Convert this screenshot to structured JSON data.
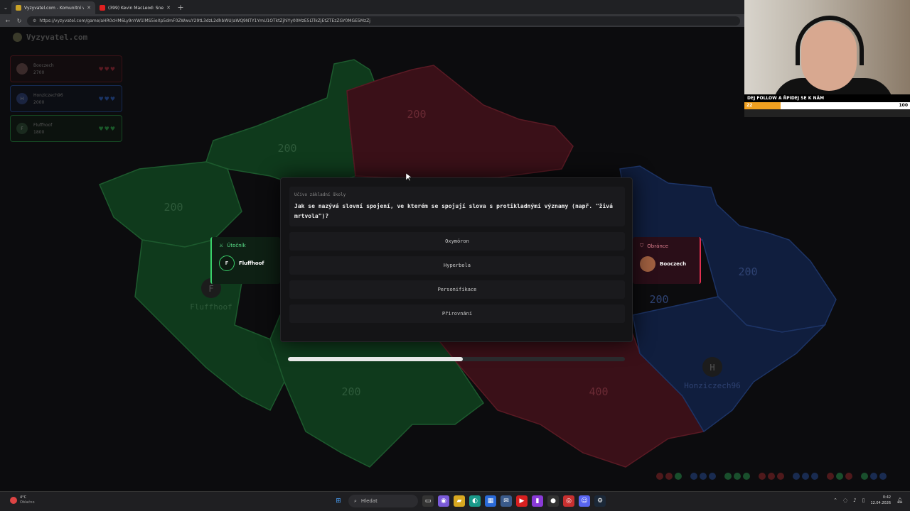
{
  "browser": {
    "tabs": [
      {
        "title": "Vyzyvatel.com - Komunitní vědom",
        "active": true,
        "favicon_color": "#c9a227"
      },
      {
        "title": "(399) Kevin MacLeod: Sneaky",
        "active": false,
        "favicon_color": "#e02020"
      }
    ],
    "new_tab": "+",
    "url": "https://vyzyvatel.com/game/aHR0cHM6Ly9nYW1lMS5ieXp5dmF0ZWwuY29tL3dzL2dhbWU/aWQ9NTY1YmU1OTktZjhlYy00MzE5LTlkZjEtZTEzZGY0MGE5MzZj"
  },
  "game": {
    "logo": "Vyzyvatel.com",
    "players": [
      {
        "name": "Booczech",
        "score": "2700",
        "hearts": "♥♥♥",
        "color": "#7a1e22"
      },
      {
        "name": "Honziczech96",
        "score": "2000",
        "hearts": "♥♥♥",
        "color": "#1e3a7a"
      },
      {
        "name": "Fluffhoof",
        "score": "1800",
        "hearts": "♥♥♥",
        "color": "#1e6a32"
      }
    ],
    "map_labels": {
      "green_n": "200",
      "green_w": "200",
      "green_s": "200",
      "red_n": "200",
      "red_s": "400",
      "blue_e": "200",
      "blue_c": "200"
    },
    "base_markers": [
      {
        "letter": "F",
        "name": "Fluffhoof"
      },
      {
        "letter": "H",
        "name": "Honziczech96"
      }
    ],
    "attacker": {
      "role": "Útočník",
      "letter": "F",
      "name": "Fluffhoof"
    },
    "defender": {
      "role": "Obránce",
      "name": "Booczech"
    }
  },
  "question": {
    "category": "Učivo základní školy",
    "text": "Jak se nazývá slovní spojení, ve kterém se spojují slova s protikladnými významy (např. \"živá mrtvola\")?",
    "answers": [
      "Oxymóron",
      "Hyperbola",
      "Personifikace",
      "Přirovnání"
    ],
    "time_remaining_fraction": 0.52
  },
  "webcam": {
    "banner": "DEJ FOLLOW A ŘPIDEJ SE K NÁM",
    "goal_current": "22",
    "goal_target": "100",
    "goal_fraction": 0.22
  },
  "taskbar": {
    "weather_temp": "4°C",
    "weather_desc": "Oblačno",
    "search_placeholder": "Hledat",
    "time": "0:42",
    "date": "12.04.2026"
  }
}
